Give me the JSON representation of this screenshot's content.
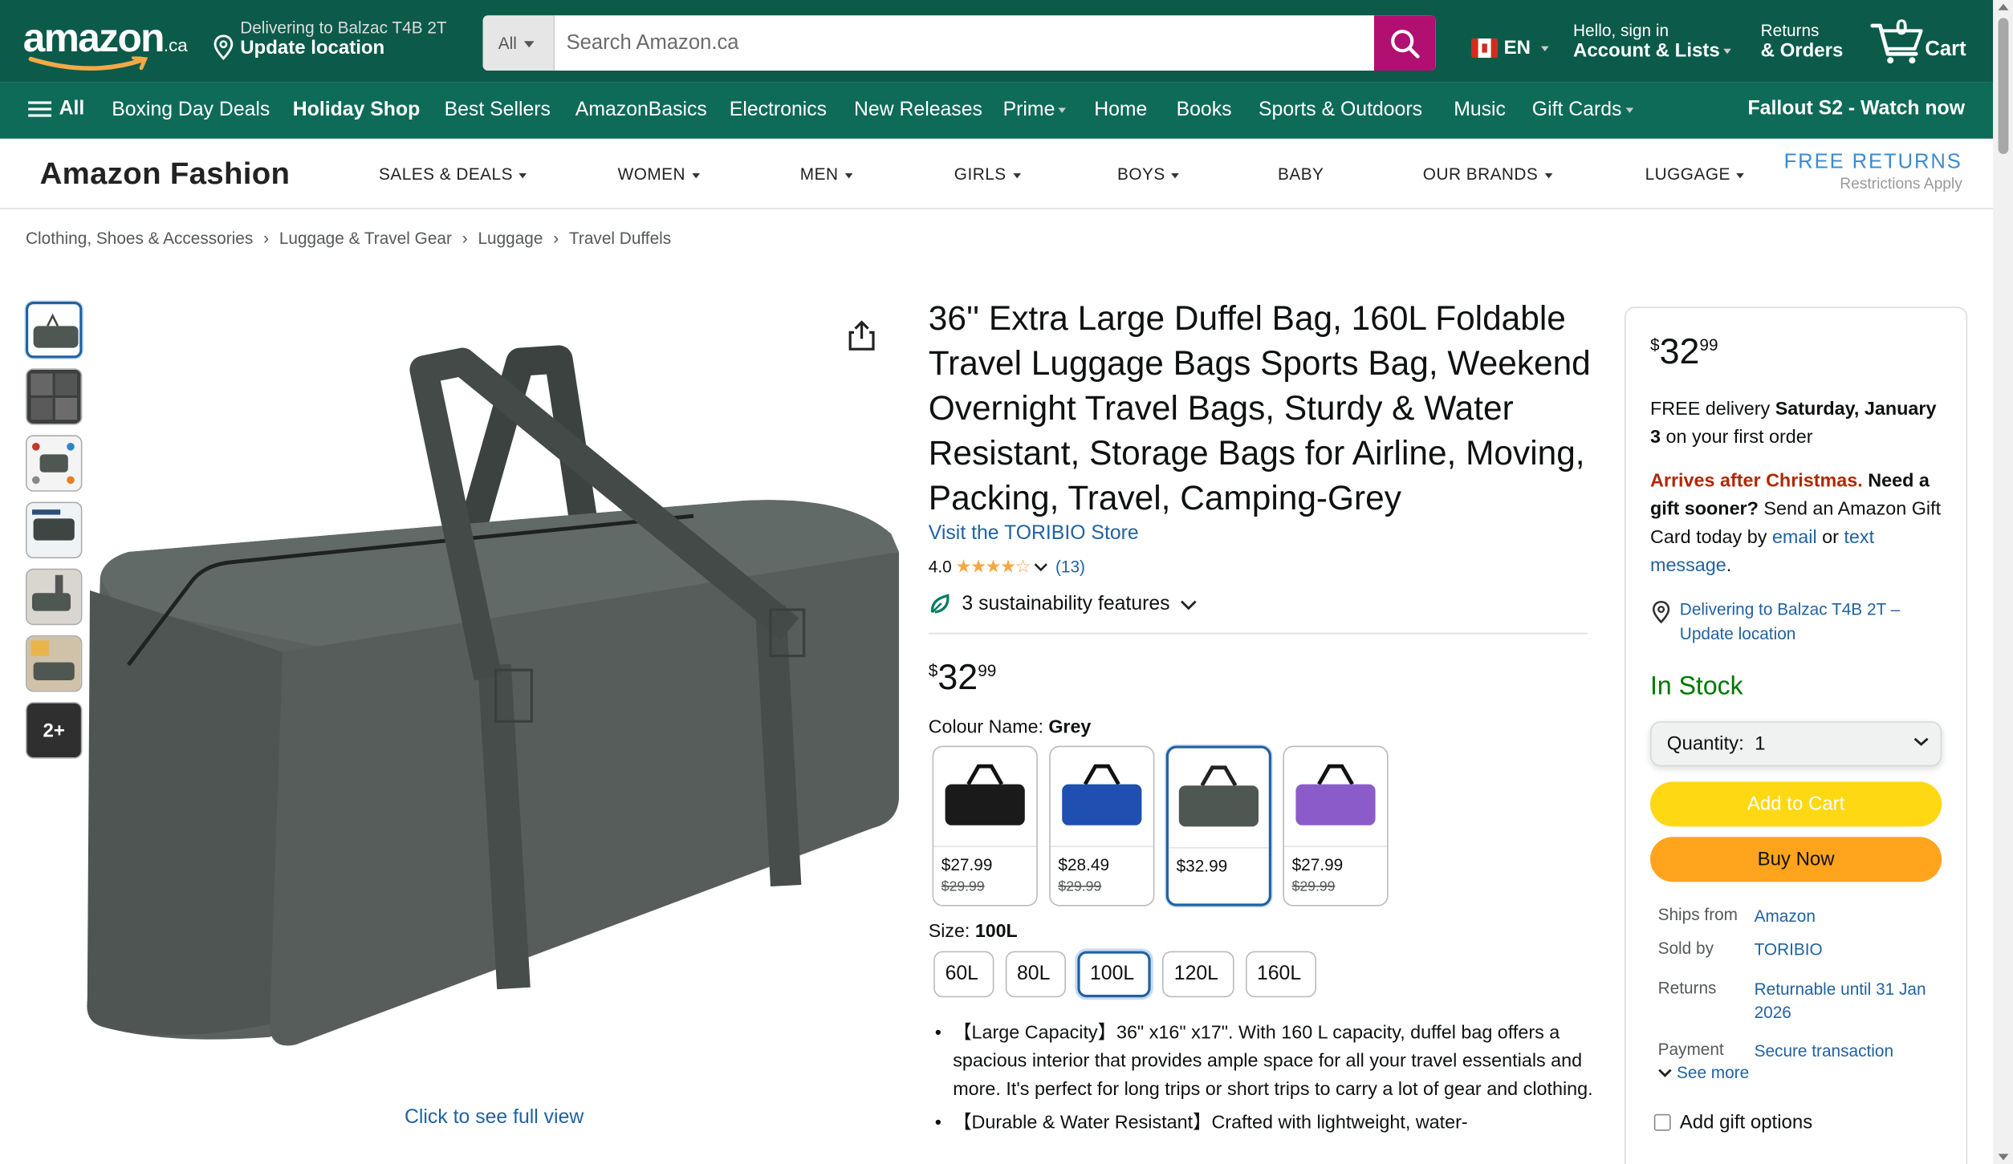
{
  "header": {
    "logo": "amazon",
    "logo_suffix": ".ca",
    "deliver_line1": "Delivering to Balzac T4B 2T",
    "deliver_line2": "Update location",
    "search_category": "All",
    "search_placeholder": "Search Amazon.ca",
    "lang": "EN",
    "account_line1": "Hello, sign in",
    "account_line2": "Account & Lists",
    "orders_line1": "Returns",
    "orders_line2": "& Orders",
    "cart_count": "0",
    "cart_label": "Cart"
  },
  "subnav": {
    "all": "All",
    "items": [
      "Boxing Day Deals",
      "Holiday Shop",
      "Best Sellers",
      "AmazonBasics",
      "Electronics",
      "New Releases",
      "Prime",
      "Home",
      "Books",
      "Sports & Outdoors",
      "Music",
      "Gift Cards"
    ],
    "promo": "Fallout S2 - Watch now"
  },
  "fashion": {
    "brand": "Amazon Fashion",
    "items": [
      "SALES & DEALS",
      "WOMEN",
      "MEN",
      "GIRLS",
      "BOYS",
      "BABY",
      "OUR BRANDS",
      "LUGGAGE"
    ],
    "free_returns": "FREE RETURNS",
    "restrictions": "Restrictions Apply"
  },
  "breadcrumb": [
    "Clothing, Shoes & Accessories",
    "Luggage & Travel Gear",
    "Luggage",
    "Travel Duffels"
  ],
  "gallery": {
    "more_label": "2+",
    "full_view": "Click to see full view"
  },
  "product": {
    "title": "36'' Extra Large Duffel Bag, 160L Foldable Travel Luggage Bags Sports Bag, Weekend Overnight Travel Bags, Sturdy & Water Resistant, Storage Bags for Airline, Moving, Packing, Travel, Camping-Grey",
    "store": "Visit the TORIBIO Store",
    "rating": "4.0",
    "stars": "★★★★☆",
    "review_count": "(13)",
    "sustainability": "3 sustainability features",
    "price_symbol": "$",
    "price_whole": "32",
    "price_fraction": "99",
    "colour_label": "Colour Name:",
    "colour_value": "Grey",
    "colours": [
      {
        "name": "Black",
        "color": "#1a1a1a",
        "price": "$27.99",
        "old_price": "$29.99"
      },
      {
        "name": "Blue",
        "color": "#1f4fb0",
        "price": "$28.49",
        "old_price": "$29.99"
      },
      {
        "name": "Grey",
        "color": "#4f5753",
        "price": "$32.99",
        "old_price": ""
      },
      {
        "name": "Purple",
        "color": "#8b5cc9",
        "price": "$27.99",
        "old_price": "$29.99"
      }
    ],
    "size_label": "Size:",
    "size_value": "100L",
    "sizes": [
      "60L",
      "80L",
      "100L",
      "120L",
      "160L"
    ],
    "bullets": [
      "【Large Capacity】36\" x16\" x17\". With 160 L capacity, duffel bag offers a spacious interior that provides ample space for all your travel essentials and more. It's perfect for long trips or short trips to carry a lot of gear and clothing.",
      "【Durable & Water Resistant】Crafted with lightweight, water-"
    ]
  },
  "buybox": {
    "price_symbol": "$",
    "price_whole": "32",
    "price_fraction": "99",
    "delivery_prefix": "FREE delivery ",
    "delivery_date": "Saturday, January 3",
    "delivery_suffix": " on your first order",
    "arrives": "Arrives after Christmas.",
    "need_gift": " Need a gift sooner?",
    "send_text": " Send an Amazon Gift Card today by ",
    "email": "email",
    "or": " or ",
    "text_message": "text message",
    "period": ".",
    "location": "Delivering to Balzac T4B 2T – Update location",
    "stock": "In Stock",
    "quantity": "Quantity:  1",
    "add_to_cart": "Add to Cart",
    "buy_now": "Buy Now",
    "ships_from_label": "Ships from",
    "ships_from": "Amazon",
    "sold_by_label": "Sold by",
    "sold_by": "TORIBIO",
    "returns_label": "Returns",
    "returns": "Returnable until 31 Jan 2026",
    "payment_label": "Payment",
    "payment": "Secure transaction",
    "see_more": "See more",
    "gift_options": "Add gift options"
  },
  "colors": {
    "nav_bg": "#0b5a4a",
    "subnav_bg": "#0e6b58",
    "search_btn": "#b10f72",
    "link": "#2162a1",
    "add_to_cart": "#ffd814",
    "buy_now": "#ffa41c",
    "in_stock": "#007600",
    "alert": "#b12704"
  }
}
